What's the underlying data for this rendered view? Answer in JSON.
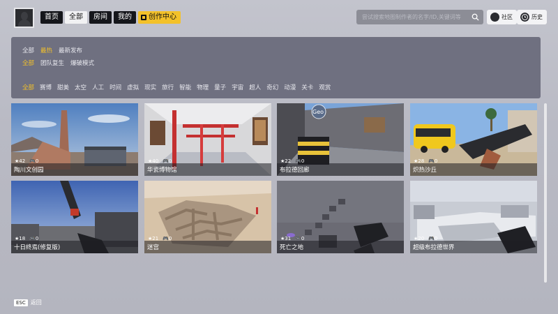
{
  "topnav": {
    "tabs": [
      {
        "label": "首页",
        "active": false
      },
      {
        "label": "全部",
        "active": true
      },
      {
        "label": "房间",
        "active": false
      },
      {
        "label": "我的",
        "active": false
      }
    ],
    "create_label": "创作中心"
  },
  "search": {
    "placeholder": "尝试搜索地图制作者的名字/ID,关键词等"
  },
  "community_label": "社区",
  "history_label": "历史",
  "filter": {
    "row1": [
      {
        "label": "全部",
        "active": false
      },
      {
        "label": "最热",
        "active": true
      },
      {
        "label": "最新发布",
        "active": false
      }
    ],
    "row2": [
      {
        "label": "全部",
        "active": true
      },
      {
        "label": "团队复生",
        "active": false
      },
      {
        "label": "爆破模式",
        "active": false
      }
    ],
    "row3": [
      {
        "label": "全部",
        "active": true
      },
      {
        "label": "赛博",
        "active": false
      },
      {
        "label": "甜美",
        "active": false
      },
      {
        "label": "太空",
        "active": false
      },
      {
        "label": "人工",
        "active": false
      },
      {
        "label": "时间",
        "active": false
      },
      {
        "label": "虚拟",
        "active": false
      },
      {
        "label": "现实",
        "active": false
      },
      {
        "label": "旅行",
        "active": false
      },
      {
        "label": "智能",
        "active": false
      },
      {
        "label": "物理",
        "active": false
      },
      {
        "label": "量子",
        "active": false
      },
      {
        "label": "宇宙",
        "active": false
      },
      {
        "label": "超人",
        "active": false
      },
      {
        "label": "奇幻",
        "active": false
      },
      {
        "label": "动漫",
        "active": false
      },
      {
        "label": "关卡",
        "active": false
      },
      {
        "label": "观赏",
        "active": false
      }
    ]
  },
  "maps": [
    {
      "title": "陶川文创园",
      "stars": "42",
      "players": "0"
    },
    {
      "title": "华瓷博物馆",
      "stars": "40",
      "players": "0"
    },
    {
      "title": "布拉德回廊",
      "stars": "22",
      "players": "0"
    },
    {
      "title": "炽热沙丘",
      "stars": "28",
      "players": "0"
    },
    {
      "title": "十日终焉(修复版)",
      "stars": "18",
      "players": "0"
    },
    {
      "title": "迷宫",
      "stars": "21",
      "players": "0"
    },
    {
      "title": "死亡之地",
      "stars": "31",
      "players": "0"
    },
    {
      "title": "超级布拉德世界",
      "stars": "20",
      "players": "0"
    }
  ],
  "card2_sign": "Geo",
  "footer": {
    "key": "ESC",
    "label": "返回"
  }
}
